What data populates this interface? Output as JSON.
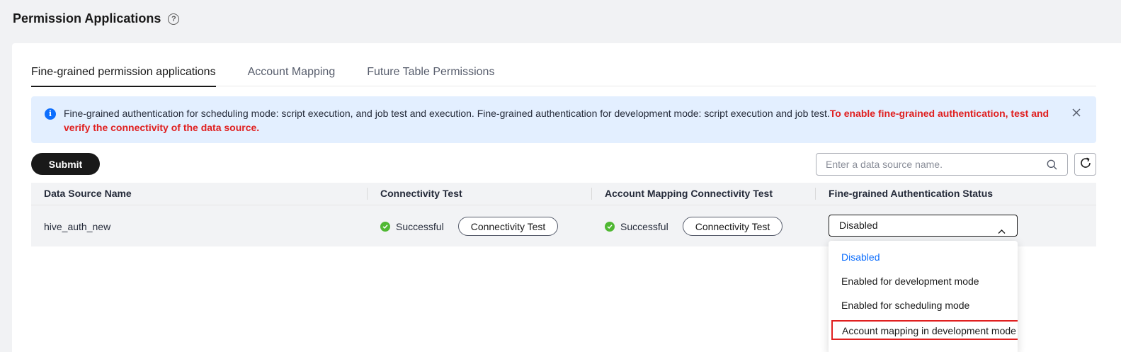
{
  "page": {
    "title": "Permission Applications",
    "help_icon": "question-circle-icon"
  },
  "tabs": [
    {
      "label": "Fine-grained permission applications",
      "active": true
    },
    {
      "label": "Account Mapping",
      "active": false
    },
    {
      "label": "Future Table Permissions",
      "active": false
    }
  ],
  "notice": {
    "text": "Fine-grained authentication for scheduling mode: script execution, and job test and execution. Fine-grained authentication for development mode: script execution and job test.",
    "highlight": "To enable fine-grained authentication, test and verify the connectivity of the data source.",
    "icon": "info-icon",
    "close_icon": "close-icon"
  },
  "toolbar": {
    "submit_label": "Submit",
    "search_placeholder": "Enter a data source name.",
    "search_icon": "search-icon",
    "refresh_icon": "refresh-icon"
  },
  "table": {
    "columns": [
      "Data Source Name",
      "Connectivity Test",
      "Account Mapping Connectivity Test",
      "Fine-grained Authentication Status"
    ],
    "rows": [
      {
        "data_source": "hive_auth_new",
        "connectivity_status": "Successful",
        "connectivity_button": "Connectivity Test",
        "mapping_status": "Successful",
        "mapping_button": "Connectivity Test",
        "auth_status": "Disabled"
      }
    ]
  },
  "dropdown": {
    "options": [
      {
        "label": "Disabled",
        "selected": true
      },
      {
        "label": "Enabled for development mode",
        "selected": false
      },
      {
        "label": "Enabled for scheduling mode",
        "selected": false
      },
      {
        "label": "Account mapping in development mode en",
        "selected": false,
        "highlighted": true
      }
    ]
  },
  "colors": {
    "accent": "#0d6efd",
    "success": "#50b833",
    "danger": "#e02020",
    "primary_button": "#191919"
  }
}
